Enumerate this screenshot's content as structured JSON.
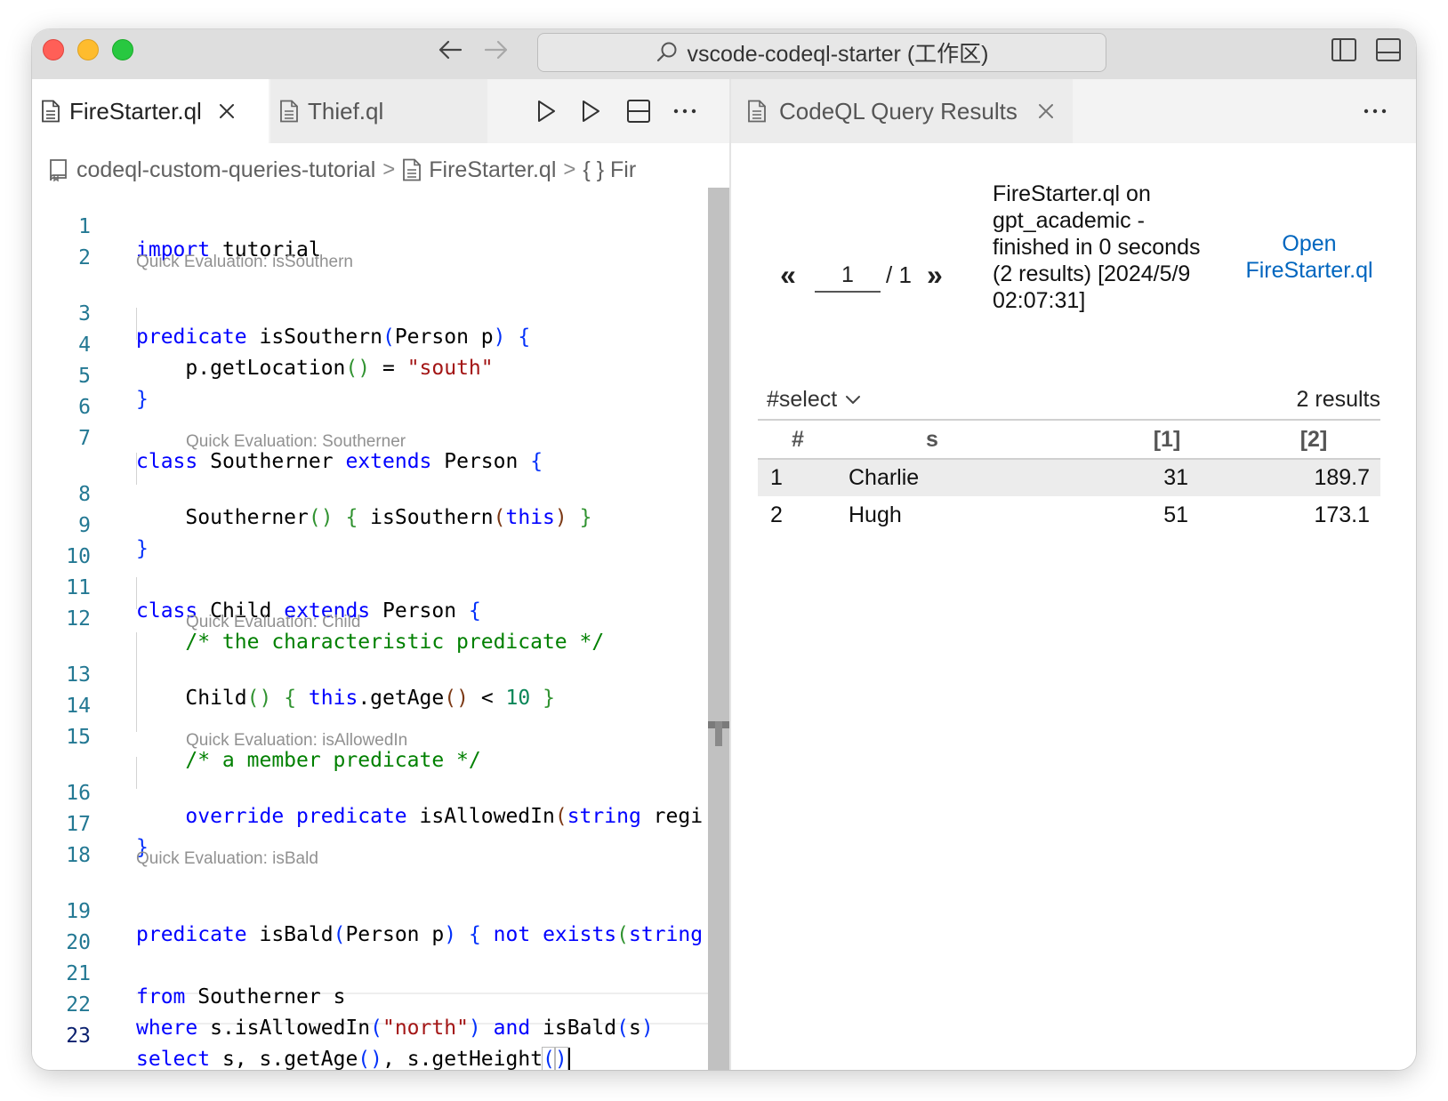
{
  "window": {
    "command_center": "vscode-codeql-starter (工作区)"
  },
  "editor": {
    "tabs": [
      {
        "label": "FireStarter.ql",
        "active": true
      },
      {
        "label": "Thief.ql",
        "active": false
      }
    ],
    "breadcrumb": [
      "codeql-custom-queries-tutorial",
      "FireStarter.ql",
      "{ } Fir"
    ],
    "line_numbers": [
      "1",
      "2",
      "3",
      "4",
      "5",
      "6",
      "7",
      "8",
      "9",
      "10",
      "11",
      "12",
      "13",
      "14",
      "15",
      "16",
      "17",
      "18",
      "19",
      "20",
      "21",
      "22",
      "23"
    ],
    "code": [
      "import",
      "tutorial",
      "predicate",
      "isSouthern",
      "(",
      "Person p",
      ")",
      "{",
      "p.getLocation",
      "()",
      "=",
      "\"south\"",
      "}",
      "class",
      "Southerner",
      "extends",
      "Person",
      "{",
      "Southerner",
      "()",
      "{",
      "isSouthern",
      "(",
      "this",
      ")",
      "}",
      "}",
      "class",
      "Child",
      "extends",
      "Person",
      "{",
      "/* the characteristic predicate */",
      "Child",
      "()",
      "{",
      "this",
      ".getAge",
      "()",
      "<",
      "10",
      "}",
      "/* a member predicate */",
      "override",
      "predicate",
      "isAllowedIn",
      "(",
      "string",
      "regi",
      "}",
      "predicate",
      "isBald",
      "(",
      "Person p",
      ")",
      "{",
      "not",
      "exists",
      "(",
      "string",
      "from",
      "Southerner s",
      "where",
      "s.isAllowedIn",
      "(",
      "\"north\"",
      ")",
      "and",
      "isBald",
      "(",
      "s",
      ")",
      "select",
      "s,",
      "s.getAge",
      "()",
      ",",
      "s.getHeight",
      "(",
      ")"
    ],
    "codelens": [
      "Quick Evaluation: isSouthern",
      "Quick Evaluation: Southerner",
      "Quick Evaluation: Child",
      "Quick Evaluation: isAllowedIn",
      "Quick Evaluation: isBald"
    ]
  },
  "results": {
    "tab_label": "CodeQL Query Results",
    "pager": {
      "prev": "«",
      "page": "1",
      "total": "/ 1",
      "next": "»"
    },
    "query_info": "FireStarter.ql on gpt_academic - finished in 0 seconds (2 results) [2024/5/9 02:07:31]",
    "open_link": "Open FireStarter.ql",
    "select_label": "#select",
    "result_count": "2 results",
    "columns": [
      "#",
      "s",
      "[1]",
      "[2]"
    ],
    "rows": [
      [
        "1",
        "Charlie",
        "31",
        "189.7"
      ],
      [
        "2",
        "Hugh",
        "51",
        "173.1"
      ]
    ]
  }
}
